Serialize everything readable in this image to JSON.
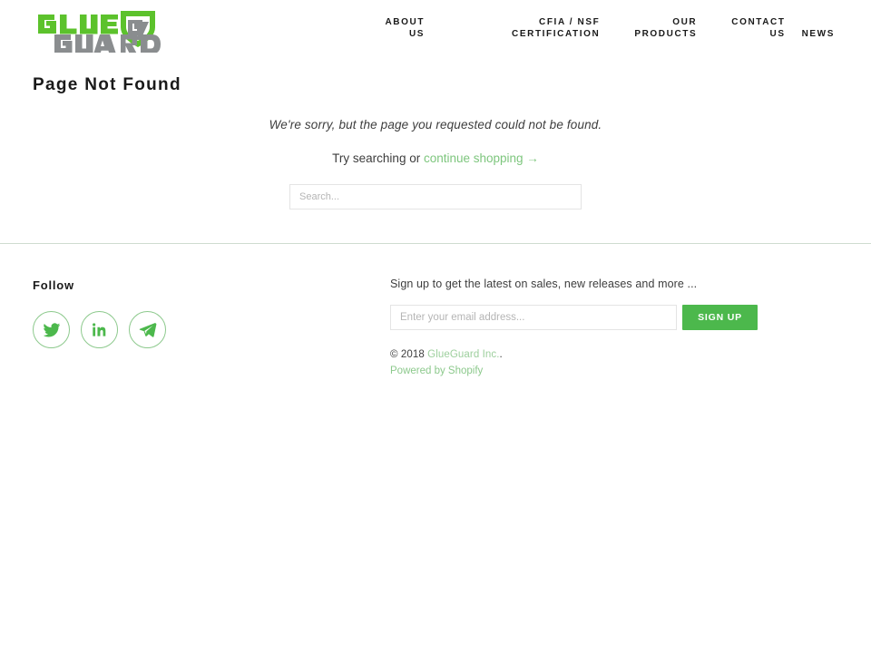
{
  "brand": {
    "logo_text_top": "GLUE",
    "logo_text_bottom": "GUARD",
    "green": "#5cc22c",
    "gray": "#8a8d8f"
  },
  "header": {
    "nav": [
      {
        "name": "about-us",
        "line1": "ABOUT",
        "line2": "US"
      },
      {
        "name": "cfia-nsf-certification",
        "line1": "CFIA / NSF",
        "line2": "CERTIFICATION"
      },
      {
        "name": "our-products",
        "line1": "OUR",
        "line2": "PRODUCTS"
      },
      {
        "name": "contact-us",
        "line1": "CONTACT",
        "line2": "US"
      },
      {
        "name": "news",
        "line1": "NEWS",
        "line2": ""
      }
    ]
  },
  "main": {
    "title": "Page Not Found",
    "sorry_text": "We're sorry, but the page you requested could not be found.",
    "try_text": "Try searching or",
    "continue_link": "continue shopping →",
    "search_placeholder": "Search...",
    "search_value": ""
  },
  "footer": {
    "follow_heading": "Follow",
    "social": [
      {
        "name": "twitter-icon",
        "label": "Twitter"
      },
      {
        "name": "linkedin-icon",
        "label": "LinkedIn"
      },
      {
        "name": "telegram-icon",
        "label": "Telegram"
      }
    ],
    "newsletter_text": "Sign up to get the latest on sales, new releases and more ...",
    "email_placeholder": "Enter your email address...",
    "email_value": "",
    "signup_label": "SIGN UP",
    "copyright_prefix": "© 2018",
    "copyright_brand": "GlueGuard Inc.",
    "copyright_suffix": ".",
    "powered_by": "Powered by Shopify",
    "accent_green": "#4cb84c",
    "link_green": "#8cc98c",
    "divider_color": "#cfdcd0"
  }
}
